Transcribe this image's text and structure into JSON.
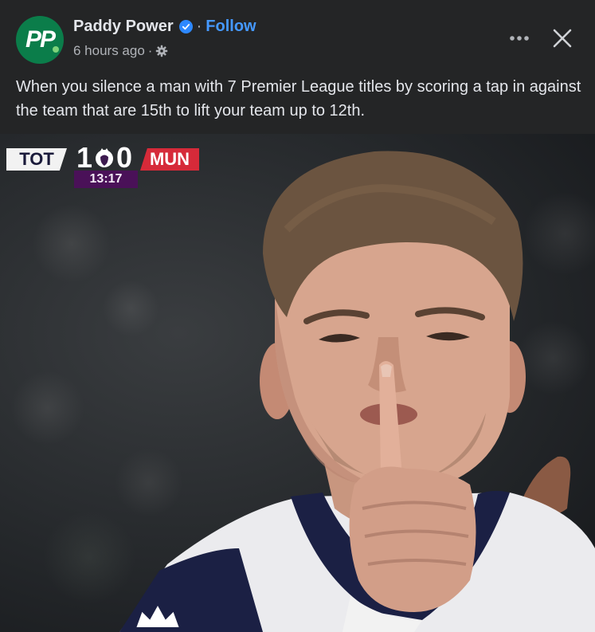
{
  "post": {
    "page_name": "Paddy Power",
    "follow_label": "Follow",
    "separator": "·",
    "time": "6 hours ago",
    "meta_separator": "·",
    "caption": "When you silence a man with 7 Premier League titles by scoring a tap in against the team that are 15th to lift your team up to 12th.",
    "avatar_logo": "PP",
    "icons": {
      "verified": "verified-badge-icon",
      "privacy": "gear-icon",
      "more": "more-options-icon",
      "close": "close-icon"
    },
    "colors": {
      "background": "#242526",
      "follow": "#4599ff",
      "verified": "#2d88ff",
      "avatar": "#0b7d4a"
    }
  },
  "media": {
    "score_bug": {
      "home_team": "TOT",
      "home_score": "1",
      "away_score": "0",
      "away_team": "MUN",
      "clock": "13:17"
    }
  }
}
